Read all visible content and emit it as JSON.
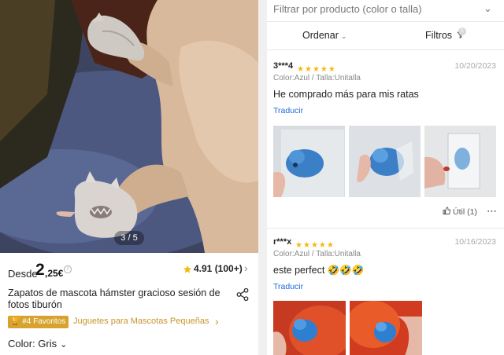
{
  "product": {
    "image_counter": "3 / 5",
    "price_prefix": "Desde",
    "price_int": "2",
    "price_dec": ",25€",
    "rating": "4.91 (100+)",
    "title": "Zapatos de mascota hámster gracioso sesión de fotos tiburón",
    "badge": "#4 Favoritos",
    "category": "Juguetes para Mascotas Pequeñas",
    "color_label": "Color: Gris"
  },
  "reviews_panel": {
    "filter_placeholder": "Filtrar por producto (color o talla)",
    "sort_label": "Ordenar",
    "filters_label": "Filtros",
    "filters_count": "1",
    "reviews": [
      {
        "user": "3***4",
        "stars": 5,
        "date": "10/20/2023",
        "attributes": "Color:Azul / Talla:Unitalla",
        "text": "He comprado más para mis ratas",
        "translate": "Traducir",
        "helpful": "Útil (1)"
      },
      {
        "user": "r***x",
        "stars": 5,
        "date": "10/16/2023",
        "attributes": "Color:Azul / Talla:Unitalla",
        "text": "este perfect 🤣🤣🤣",
        "translate": "Traducir"
      }
    ]
  },
  "colors": {
    "star": "#f5b80c",
    "link": "#1f6bd8",
    "gold": "#d7a32c"
  },
  "icons": [
    "info-icon",
    "star-icon",
    "chevron-right-icon",
    "share-icon",
    "trophy-icon",
    "chevron-down-icon",
    "filter-icon",
    "thumbs-up-icon",
    "more-icon"
  ]
}
